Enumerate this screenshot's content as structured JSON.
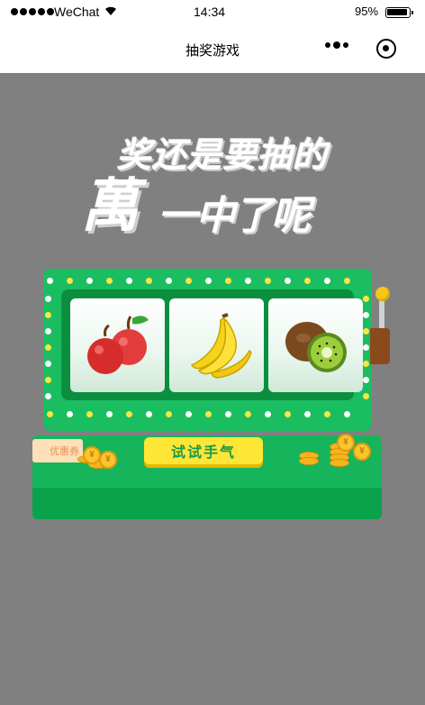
{
  "status_bar": {
    "carrier": "WeChat",
    "time": "14:34",
    "battery": "95%"
  },
  "nav": {
    "title": "抽奖游戏"
  },
  "headline": {
    "line1": "奖还是要抽的",
    "big_char": "萬",
    "line2": "一中了呢"
  },
  "machine": {
    "reels": [
      {
        "name": "apple",
        "icon": "apple-icon"
      },
      {
        "name": "banana",
        "icon": "banana-icon"
      },
      {
        "name": "kiwi",
        "icon": "kiwi-icon"
      }
    ],
    "coupon_label": "优惠券",
    "button_label": "试试手气",
    "coin_symbol": "¥"
  },
  "colors": {
    "background": "#808080",
    "machine_green": "#1bbd61",
    "frame_green": "#0b8f3f",
    "button_yellow": "#fde636",
    "button_text": "#1a9a4a"
  }
}
